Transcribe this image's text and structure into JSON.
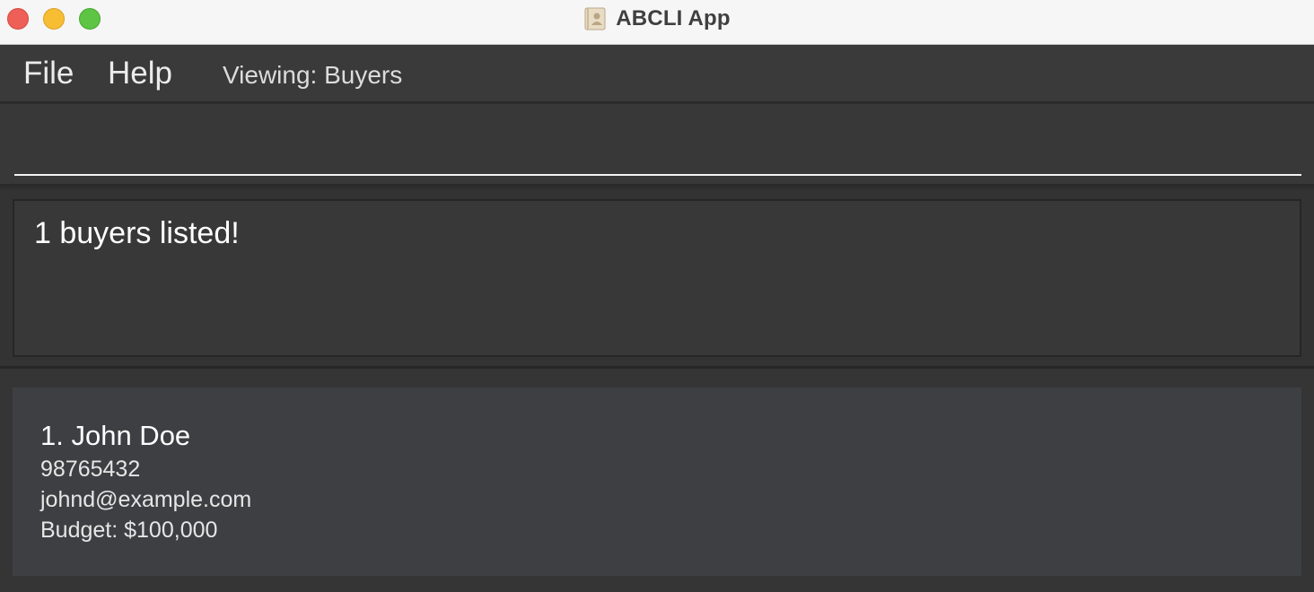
{
  "window": {
    "title": "ABCLI App",
    "title_icon": "contacts-book-icon",
    "controls": [
      "close",
      "minimize",
      "maximize"
    ]
  },
  "menu": {
    "file_label": "File",
    "help_label": "Help",
    "viewing_label": "Viewing: Buyers"
  },
  "command": {
    "value": "",
    "placeholder": ""
  },
  "result": {
    "message": "1 buyers listed!"
  },
  "buyers": [
    {
      "index_name": "1. John Doe",
      "phone": "98765432",
      "email": "johnd@example.com",
      "budget": "Budget: $100,000"
    }
  ],
  "colors": {
    "close": "#ee5f58",
    "minimize": "#f7be33",
    "maximize": "#5ec443",
    "background": "#2e2e2e",
    "card": "#3e3f42"
  }
}
